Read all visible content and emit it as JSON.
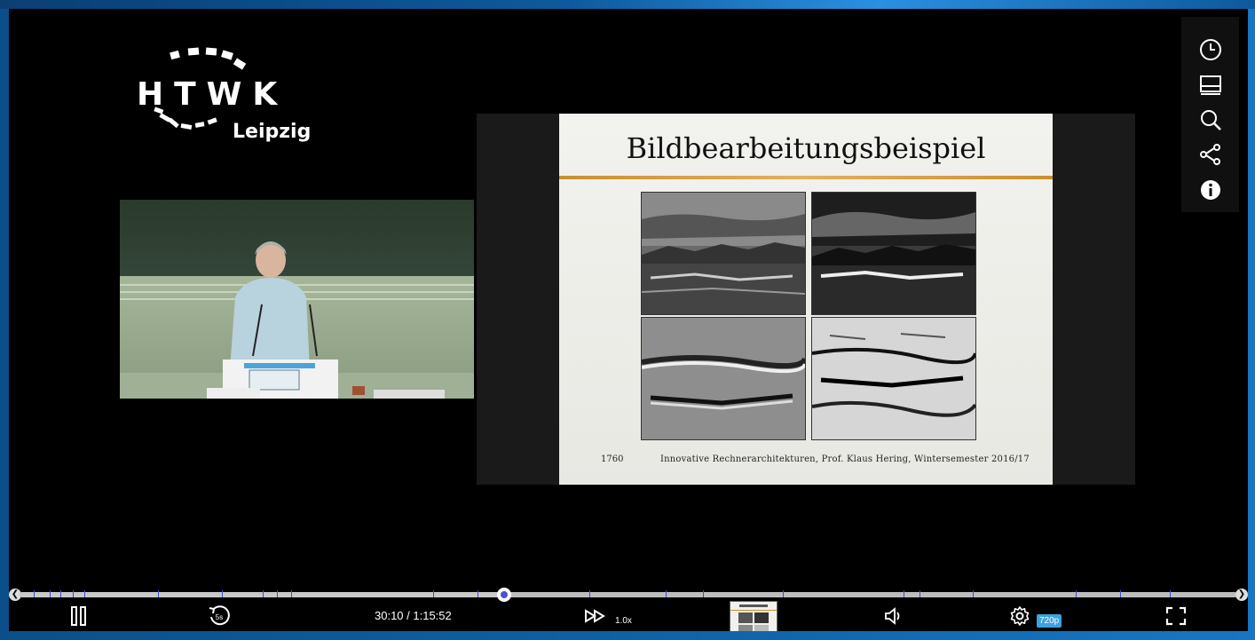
{
  "logo": {
    "word": "HTWK",
    "sub": "Leipzig"
  },
  "slide": {
    "title": "Bildbearbeitungsbeispiel",
    "page_number": "1760",
    "footer": "Innovative Rechnerarchitekturen, Prof. Klaus Hering, Wintersemester 2016/17"
  },
  "side_menu": {
    "items": [
      {
        "icon": "clock-icon"
      },
      {
        "icon": "layout-icon"
      },
      {
        "icon": "search-icon"
      },
      {
        "icon": "share-icon"
      },
      {
        "icon": "info-icon"
      }
    ]
  },
  "player": {
    "time_display": "30:10 / 1:15:52",
    "playback_rate": "1.0x",
    "quality": "720p",
    "progress_fraction": 0.3976,
    "skip_back_label": "5s"
  }
}
